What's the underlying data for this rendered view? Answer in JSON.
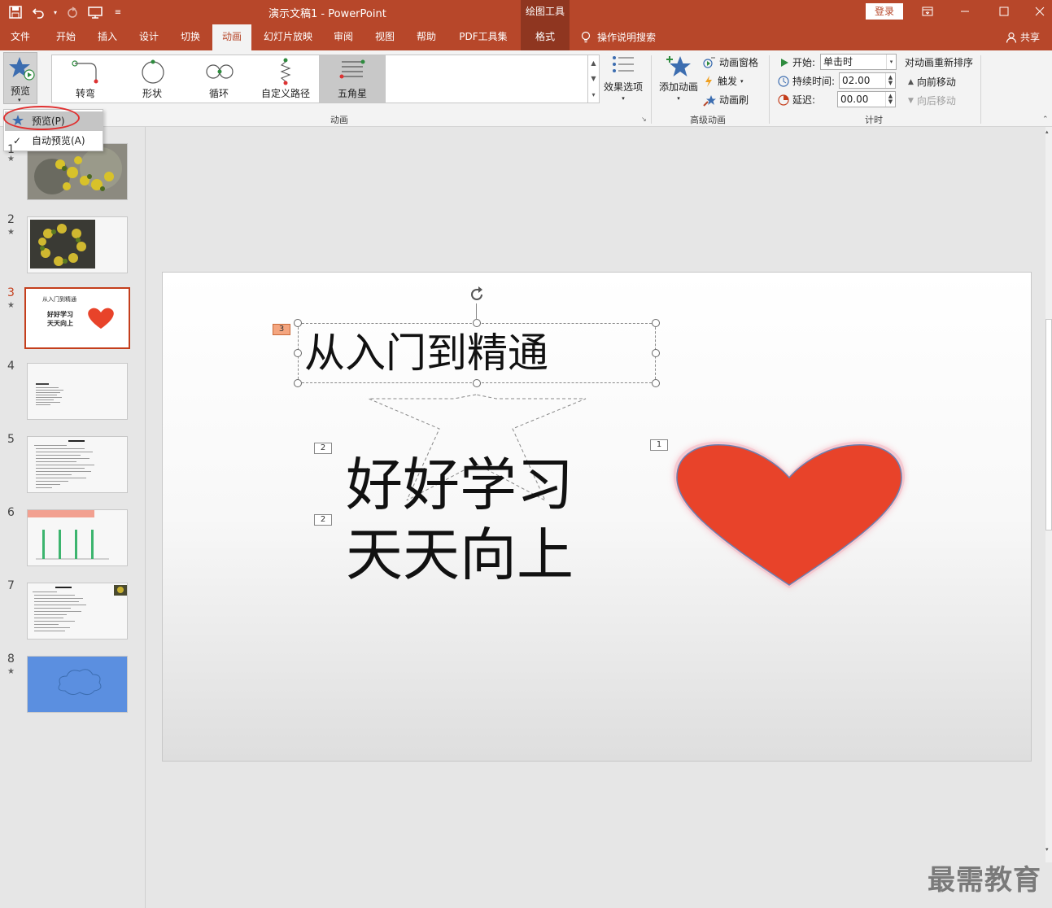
{
  "title_bar": {
    "doc_title": "演示文稿1  -  PowerPoint",
    "context_group": "绘图工具",
    "login": "登录"
  },
  "tabs": [
    {
      "label": "文件"
    },
    {
      "label": "开始"
    },
    {
      "label": "插入"
    },
    {
      "label": "设计"
    },
    {
      "label": "切换"
    },
    {
      "label": "动画"
    },
    {
      "label": "幻灯片放映"
    },
    {
      "label": "审阅"
    },
    {
      "label": "视图"
    },
    {
      "label": "帮助"
    },
    {
      "label": "PDF工具集"
    },
    {
      "label": "格式"
    }
  ],
  "tell_me": "操作说明搜索",
  "share": "共享",
  "ribbon": {
    "preview_label": "预览",
    "gallery": [
      "转弯",
      "形状",
      "循环",
      "自定义路径",
      "五角星"
    ],
    "effect_options": "效果选项",
    "group_animation": "动画",
    "add_animation": "添加动画",
    "animation_pane": "动画窗格",
    "trigger": "触发",
    "animation_painter": "动画刷",
    "group_advanced": "高级动画",
    "start_label": "开始:",
    "start_value": "单击时",
    "duration_label": "持续时间:",
    "duration_value": "02.00",
    "delay_label": "延迟:",
    "delay_value": "00.00",
    "reorder_title": "对动画重新排序",
    "move_earlier": "向前移动",
    "move_later": "向后移动",
    "group_timing": "计时"
  },
  "preview_menu": {
    "preview": "预览(P)",
    "auto_preview": "自动预览(A)"
  },
  "slides": [
    {
      "num": "1",
      "star": "★"
    },
    {
      "num": "2",
      "star": "★"
    },
    {
      "num": "3",
      "star": "★",
      "title": "从入门到精通",
      "l1": "好好学习",
      "l2": "天天向上"
    },
    {
      "num": "4"
    },
    {
      "num": "5"
    },
    {
      "num": "6"
    },
    {
      "num": "7"
    },
    {
      "num": "8",
      "star": "★"
    }
  ],
  "slide": {
    "title": "从入门到精通",
    "line1": "好好学习",
    "line2": "天天向上",
    "tag_title": "3",
    "tag_line1": "2",
    "tag_line2": "2",
    "tag_heart": "1"
  },
  "watermark": "最需教育",
  "colors": {
    "accent": "#b7472a",
    "heart": "#e8432a"
  }
}
